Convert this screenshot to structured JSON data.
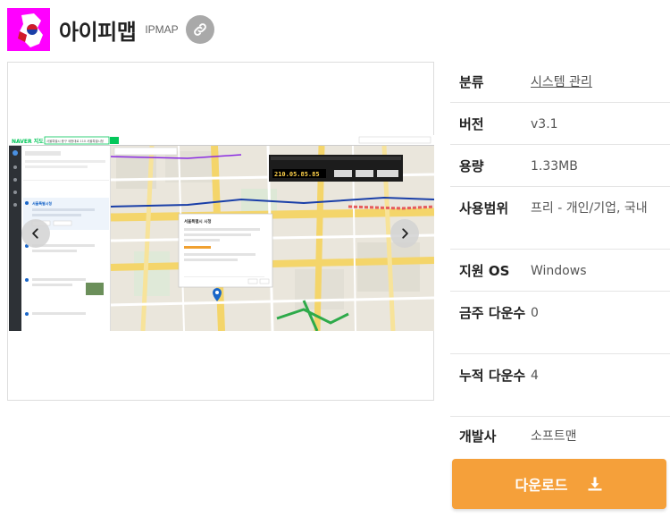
{
  "app": {
    "title": "아이피맵",
    "subtitle": "IPMAP"
  },
  "details": [
    {
      "label": "분류",
      "value": "시스템 관리",
      "link": true
    },
    {
      "label": "버전",
      "value": "v3.1"
    },
    {
      "label": "용량",
      "value": "1.33MB"
    },
    {
      "label": "사용범위",
      "value": "프리 - 개인/기업, 국내"
    },
    {
      "label": "지원 OS",
      "value": "Windows"
    },
    {
      "label": "금주 다운수",
      "value": "0"
    },
    {
      "label": "누적 다운수",
      "value": "4"
    },
    {
      "label": "개발사",
      "value": "소프트맨"
    }
  ],
  "download": {
    "label": "다운로드"
  },
  "screenshot": {
    "map_brand": "NAVER 지도",
    "search_text": "서울특별시 중구 세종대로 110 서울특별시청",
    "ip_panel_value": "210.05.85.85",
    "popup_title": "서울특별시 시청",
    "result_title": "서울특별시청"
  },
  "colors": {
    "accent": "#f5a03a",
    "icon_bg": "#ff00ff",
    "map_green": "#03c75a"
  }
}
